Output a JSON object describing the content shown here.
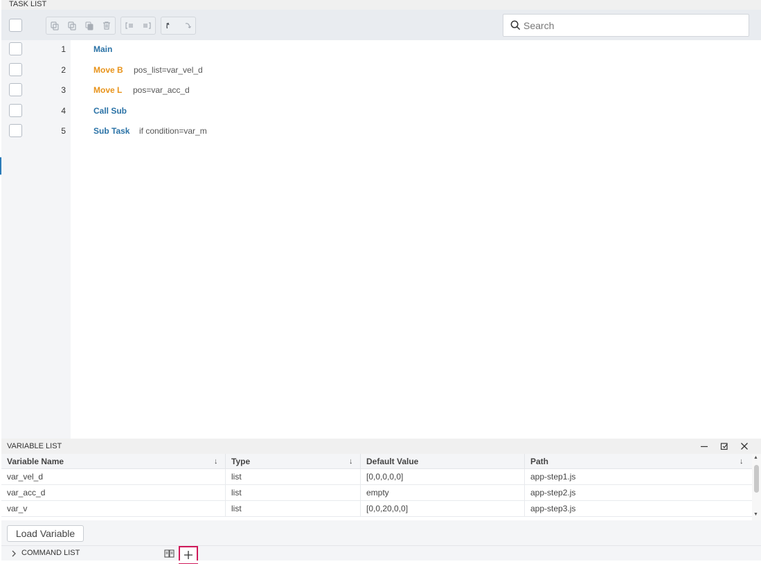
{
  "task_list": {
    "title": "TASK LIST",
    "search_placeholder": "Search",
    "rows": [
      {
        "num": "1",
        "cmd": "Main",
        "cmd_color": "#2a72a6",
        "arg": ""
      },
      {
        "num": "2",
        "cmd": "Move B",
        "cmd_color": "#e8931a",
        "arg": "pos_list=var_vel_d"
      },
      {
        "num": "3",
        "cmd": "Move L",
        "cmd_color": "#e8931a",
        "arg": "pos=var_acc_d"
      },
      {
        "num": "4",
        "cmd": "Call Sub",
        "cmd_color": "#2a72a6",
        "arg": ""
      },
      {
        "num": "5",
        "cmd": "Sub Task",
        "cmd_color": "#2a72a6",
        "arg": "if condition=var_m"
      }
    ],
    "toolbar_icons": [
      "copy-icon",
      "duplicate-icon",
      "paste-icon",
      "delete-icon",
      "outdent-icon",
      "indent-icon",
      "undo-icon",
      "redo-icon"
    ]
  },
  "variable_list": {
    "title": "VARIABLE LIST",
    "columns": [
      {
        "label": "Variable Name",
        "sort": "↓"
      },
      {
        "label": "Type",
        "sort": "↓"
      },
      {
        "label": "Default Value",
        "sort": ""
      },
      {
        "label": "Path",
        "sort": "↓"
      }
    ],
    "rows": [
      {
        "name": "var_vel_d",
        "type": "list",
        "default": "[0,0,0,0,0]",
        "path": "app-step1.js"
      },
      {
        "name": "var_acc_d",
        "type": "list",
        "default": "empty",
        "path": "app-step2.js"
      },
      {
        "name": "var_v",
        "type": "list",
        "default": "[0,0,20,0,0]",
        "path": "app-step3.js"
      }
    ],
    "load_button": "Load Variable"
  },
  "command_list": {
    "title": "COMMAND LIST"
  }
}
